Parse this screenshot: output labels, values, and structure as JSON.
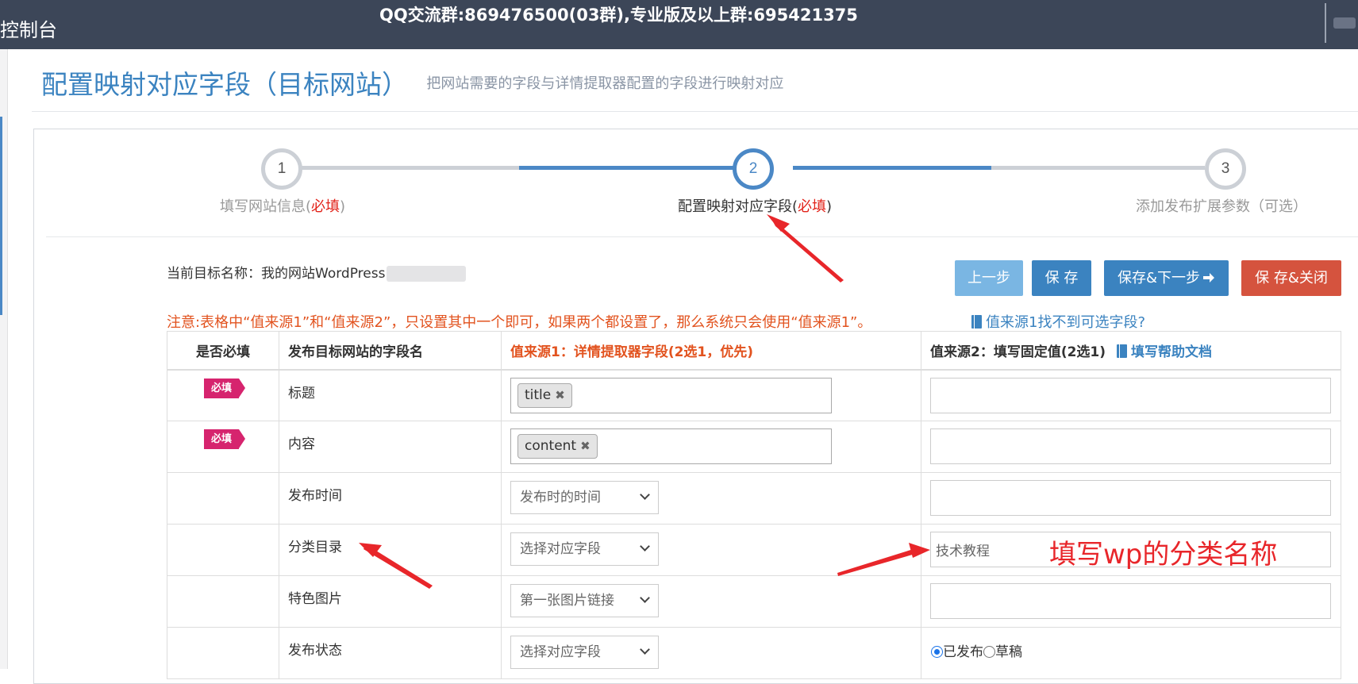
{
  "topbar": {
    "console_title": "控制台",
    "qq_notice": "QQ交流群:869476500(03群),专业版及以上群:695421375"
  },
  "page": {
    "title": "配置映射对应字段（目标网站）",
    "subtitle": "把网站需要的字段与详情提取器配置的字段进行映射对应"
  },
  "steps": [
    {
      "number": "1",
      "label": "填写网站信息(",
      "required": "必填",
      "suffix": ")"
    },
    {
      "number": "2",
      "label": "配置映射对应字段(",
      "required": "必填",
      "suffix": ")"
    },
    {
      "number": "3",
      "label": "添加发布扩展参数（可选）"
    }
  ],
  "target": {
    "prefix": "当前目标名称：",
    "name": "我的网站WordPress"
  },
  "buttons": {
    "prev": "上一步",
    "save": "保 存",
    "save_next": "保存&下一步",
    "save_close": "保 存&关闭"
  },
  "note": {
    "text": "注意:表格中“值来源1”和“值来源2”，只设置其中一个即可，如果两个都设置了，那么系统只会使用“值来源1”。",
    "link": "值来源1找不到可选字段?"
  },
  "table": {
    "headers": {
      "required": "是否必填",
      "field": "发布目标网站的字段名",
      "source1": "值来源1：详情提取器字段(2选1，优先)",
      "source2": "值来源2：填写固定值(2选1)",
      "help": "填写帮助文档"
    },
    "badge": "必填",
    "rows": [
      {
        "field": "标题",
        "tag": "title",
        "tag_x": "✖"
      },
      {
        "field": "内容",
        "tag": "content",
        "tag_x": "✖"
      },
      {
        "field": "发布时间",
        "select": "发布时的时间"
      },
      {
        "field": "分类目录",
        "select": "选择对应字段",
        "fixed_value": "技术教程"
      },
      {
        "field": "特色图片",
        "select": "第一张图片链接"
      },
      {
        "field": "发布状态",
        "select": "选择对应字段",
        "radio_published": "已发布",
        "radio_draft": "草稿"
      }
    ]
  },
  "annotation": {
    "text": "填写wp的分类名称"
  },
  "colors": {
    "topbar": "#3c4658",
    "primary": "#3b83c0",
    "light_primary": "#7ab6e3",
    "danger": "#d5533e",
    "badge": "#d6246e",
    "note": "#e2531f",
    "annotation": "#e8262a"
  }
}
